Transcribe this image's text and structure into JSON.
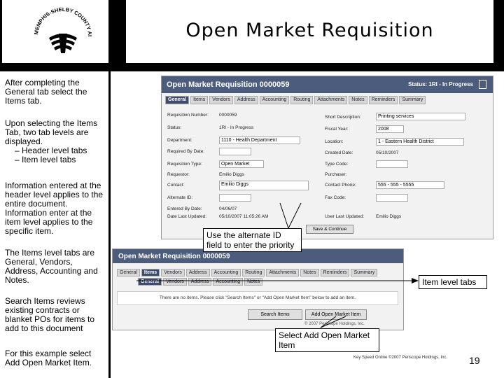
{
  "slide": {
    "title": "Open Market Requisition",
    "page_number": "19",
    "footer": "Key Speed Online ©2007  Periscope Holdings, Inc."
  },
  "logo": {
    "text": "MEMPHIS-SHELBY COUNTY AIRPORT AUTHORITY"
  },
  "left_text": {
    "p1": "After completing the General tab select the Items tab.",
    "p2": "Upon selecting the Items Tab,  two tab levels are displayed.",
    "p2_sub1": "– Header level tabs",
    "p2_sub2": "– Item level tabs",
    "p3": "Information entered at the header level applies to the entire document. Information enter at the item level applies to the specific item.",
    "p4": "The Items level tabs are General, Vendors, Address, Accounting and Notes.",
    "p5": "Search Items reviews existing contracts or blanket POs for items to add to this document",
    "p6": "For this example select Add Open Market Item."
  },
  "shot1": {
    "title": "Open Market Requisition 0000059",
    "status": "Status: 1RI - In Progress",
    "tabs": [
      "General",
      "Items",
      "Vendors",
      "Address",
      "Accounting",
      "Routing",
      "Attachments",
      "Notes",
      "Reminders",
      "Summary"
    ],
    "fields_left": [
      {
        "label": "Requisition Number:",
        "value": "0000059"
      },
      {
        "label": "Status:",
        "value": "1RI - In Progress"
      },
      {
        "label": "Department:",
        "value": "1110 - Health Department"
      },
      {
        "label": "Required By Date:",
        "value": ""
      },
      {
        "label": "Requisition Type:",
        "value": "Open Market"
      },
      {
        "label": "Requestor:",
        "value": "Emilio Diggs"
      },
      {
        "label": "Contact:",
        "value": "Emilio Diggs"
      },
      {
        "label": "Alternate ID:",
        "value": ""
      },
      {
        "label": "Entered By Date:",
        "value": "04/06/07"
      },
      {
        "label": "Date Last Updated:",
        "value": "05/10/2007 11:05:26 AM"
      }
    ],
    "fields_right": [
      {
        "label": "Short Description:",
        "value": "Printing services"
      },
      {
        "label": "Fiscal Year:",
        "value": "2008"
      },
      {
        "label": "Location:",
        "value": "1 - Eastern Health District"
      },
      {
        "label": "Created Date:",
        "value": "05/10/2007"
      },
      {
        "label": "Type Code:",
        "value": ""
      },
      {
        "label": "Purchaser:",
        "value": ""
      },
      {
        "label": "Contact Phone:",
        "value": "555 - 555 - 5555"
      },
      {
        "label": "Fax Code:",
        "value": ""
      },
      {
        "label": "",
        "value": ""
      },
      {
        "label": "User Last Updated:",
        "value": "Emilio Diggs"
      }
    ],
    "save_button": "Save & Continue"
  },
  "shot2": {
    "title": "Open Market Requisition 0000059",
    "header_tabs": [
      "General",
      "Items",
      "Vendors",
      "Address",
      "Accounting",
      "Routing",
      "Attachments",
      "Notes",
      "Reminders",
      "Summary"
    ],
    "item_tabs": [
      "General",
      "Vendors",
      "Address",
      "Accounting",
      "Notes"
    ],
    "notice": "There are no items.  Please click \"Search Items\" or \"Add Open Market Item\" below to add an item.",
    "search_button": "Search Items",
    "add_button": "Add Open Market Item",
    "copyright": "© 2007 Periscope Holdings, Inc."
  },
  "callouts": {
    "alt_id": "Use the alternate ID field to enter the priority",
    "item_tabs": "Item level tabs",
    "add_item": "Select Add Open Market Item"
  }
}
